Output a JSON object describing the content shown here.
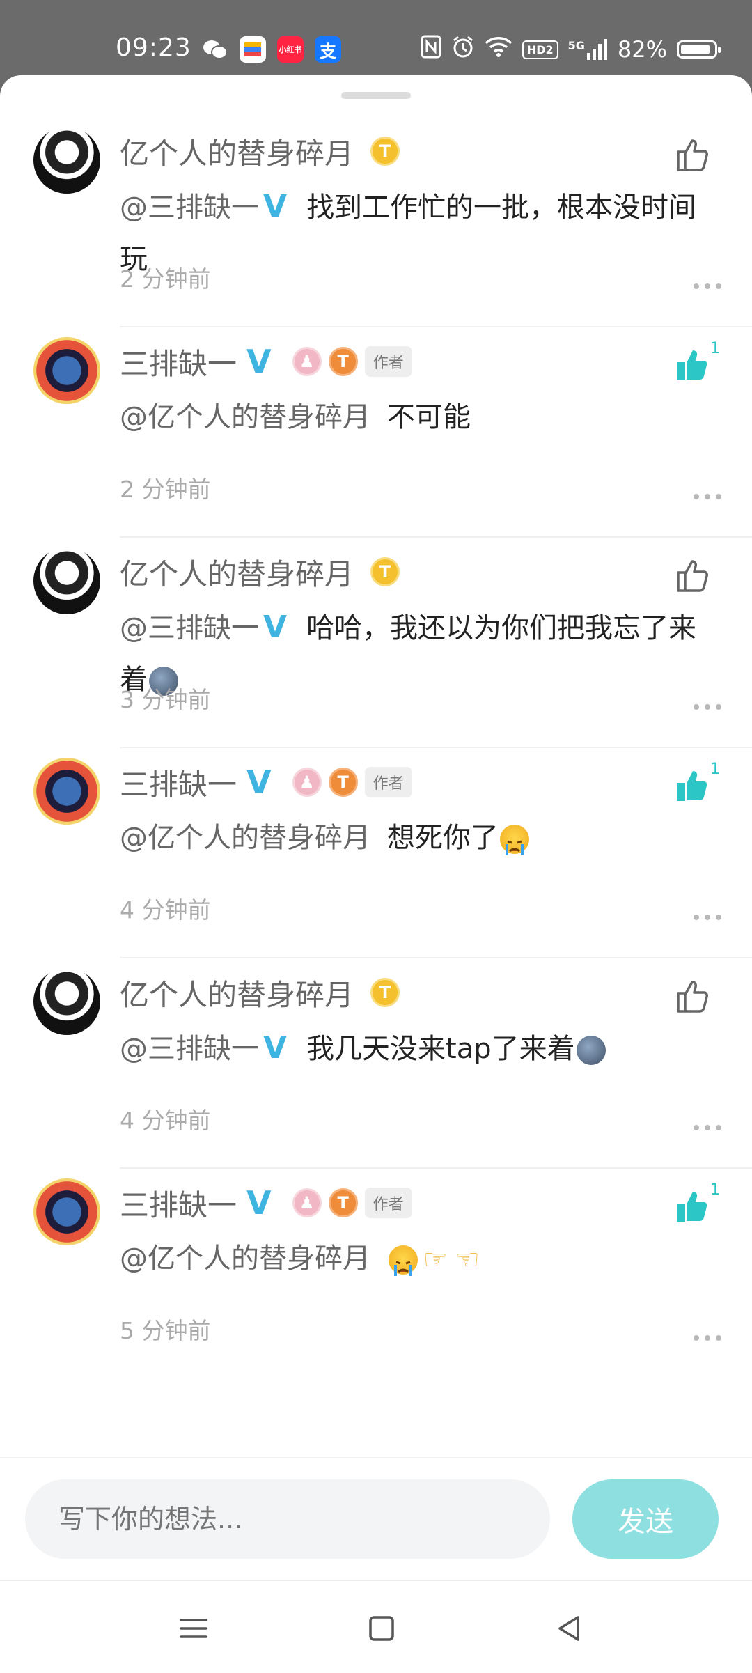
{
  "status_bar": {
    "time": "09:23",
    "apps": [
      {
        "icon": "wechat-icon",
        "color": "#ffffff",
        "label": ""
      },
      {
        "icon": "gallery-app-icon",
        "color": "#ffffff",
        "label": ""
      },
      {
        "icon": "xiaohongshu-icon",
        "color": "#ff2442",
        "label": "小红书"
      },
      {
        "icon": "alipay-icon",
        "color": "#1677ff",
        "label": "支"
      }
    ],
    "hd_label": "HD2",
    "signal_label": "5G",
    "battery": "82%"
  },
  "comments": [
    {
      "user": "亿个人的替身碎月",
      "avatar": "avatar-a1",
      "author": false,
      "mention": "@三排缺一",
      "mention_verified": true,
      "text": "找到工作忙的一批，根本没时间玩",
      "emoji": [],
      "time": "2 分钟前",
      "liked": false,
      "like_count": ""
    },
    {
      "user": "三排缺一",
      "avatar": "avatar-a2",
      "author": true,
      "author_tag": "作者",
      "mention": "@亿个人的替身碎月",
      "mention_verified": false,
      "text": "不可能",
      "emoji": [],
      "time": "2 分钟前",
      "liked": true,
      "like_count": "1"
    },
    {
      "user": "亿个人的替身碎月",
      "avatar": "avatar-a1",
      "author": false,
      "mention": "@三排缺一",
      "mention_verified": true,
      "text": "哈哈，我还以为你们把我忘了来着",
      "emoji": [
        "moon"
      ],
      "time": "3 分钟前",
      "liked": false,
      "like_count": ""
    },
    {
      "user": "三排缺一",
      "avatar": "avatar-a2",
      "author": true,
      "author_tag": "作者",
      "mention": "@亿个人的替身碎月",
      "mention_verified": false,
      "text": "想死你了",
      "emoji": [
        "cry"
      ],
      "time": "4 分钟前",
      "liked": true,
      "like_count": "1"
    },
    {
      "user": "亿个人的替身碎月",
      "avatar": "avatar-a1",
      "author": false,
      "mention": "@三排缺一",
      "mention_verified": true,
      "text": "我几天没来tap了来着",
      "emoji": [
        "moon"
      ],
      "time": "4 分钟前",
      "liked": false,
      "like_count": ""
    },
    {
      "user": "三排缺一",
      "avatar": "avatar-a2",
      "author": true,
      "author_tag": "作者",
      "mention": "@亿个人的替身碎月",
      "mention_verified": false,
      "text": "",
      "emoji": [
        "cry",
        "point-right",
        "point-left"
      ],
      "time": "5 分钟前",
      "liked": true,
      "like_count": "1"
    }
  ],
  "input": {
    "placeholder": "写下你的想法...",
    "send_label": "发送"
  },
  "colors": {
    "accent": "#2cc6c6",
    "send_bg": "#8edfe0",
    "verified": "#3fb4e0"
  }
}
